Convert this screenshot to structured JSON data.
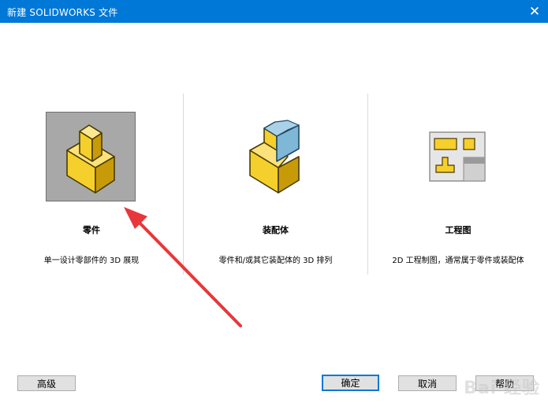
{
  "window": {
    "title": "新建 SOLIDWORKS 文件",
    "close_glyph": "✕"
  },
  "templates": [
    {
      "label": "零件",
      "description": "单一设计零部件的 3D 展现",
      "selected": true,
      "icon": "part-icon"
    },
    {
      "label": "装配体",
      "description": "零件和/或其它装配体的 3D 排列",
      "selected": false,
      "icon": "assembly-icon"
    },
    {
      "label": "工程图",
      "description": "2D 工程制图，通常属于零件或装配体",
      "selected": false,
      "icon": "drawing-icon"
    }
  ],
  "buttons": {
    "advanced": "高级",
    "ok": "确定",
    "cancel": "取消",
    "help": "帮助"
  },
  "colors": {
    "titlebar": "#0078d7",
    "part_yellow": "#f5cf2c",
    "assembly_blue": "#7fb7d6",
    "selected_bg": "#a8a8a8",
    "arrow_red": "#e8373a"
  },
  "watermark": "Bai 经验"
}
